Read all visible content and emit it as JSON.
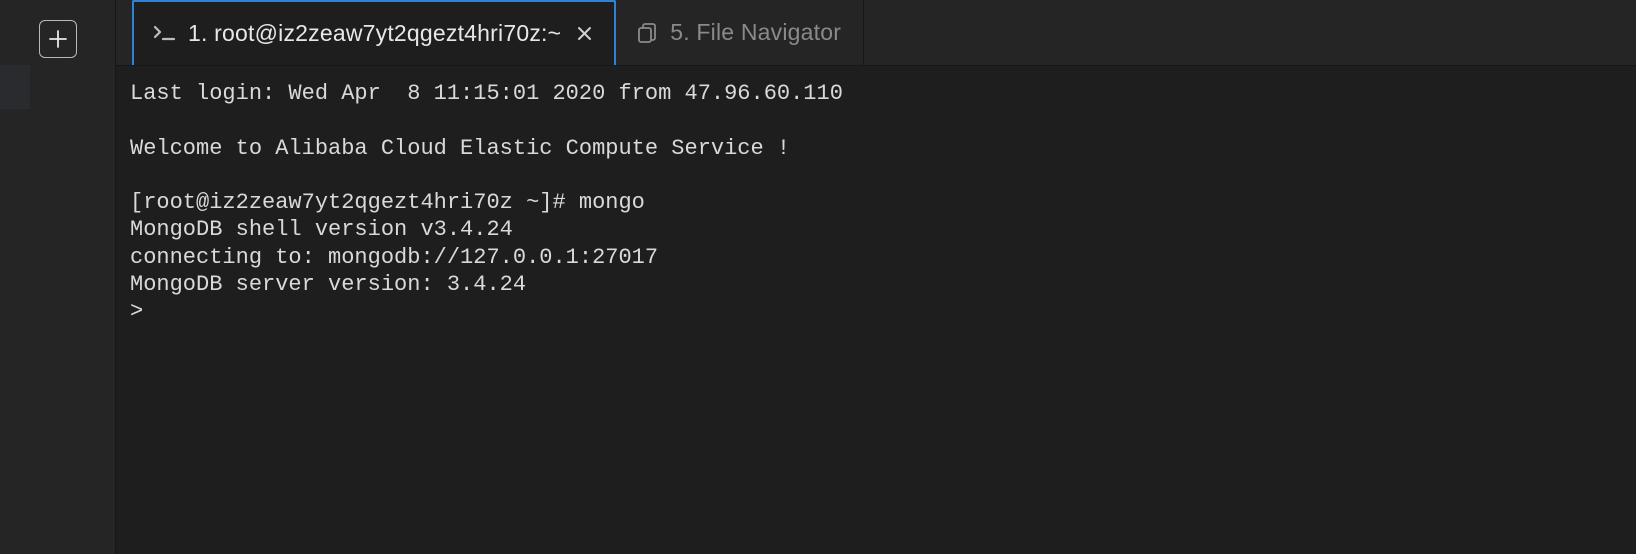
{
  "tabs": {
    "active": {
      "label": "1. root@iz2zeaw7yt2qgezt4hri70z:~"
    },
    "inactive": {
      "label": "5. File Navigator"
    }
  },
  "terminal": {
    "line1": "Last login: Wed Apr  8 11:15:01 2020 from 47.96.60.110",
    "line2": "",
    "line3": "Welcome to Alibaba Cloud Elastic Compute Service !",
    "line4": "",
    "line5": "[root@iz2zeaw7yt2qgezt4hri70z ~]# mongo",
    "line6": "MongoDB shell version v3.4.24",
    "line7": "connecting to: mongodb://127.0.0.1:27017",
    "line8": "MongoDB server version: 3.4.24",
    "line9": ">"
  }
}
